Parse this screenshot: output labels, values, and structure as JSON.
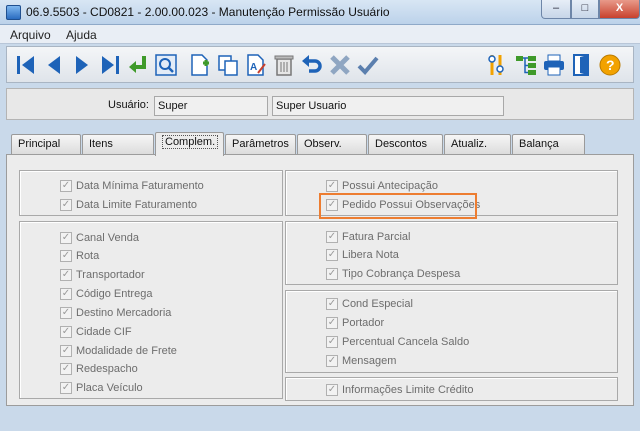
{
  "window": {
    "title": "06.9.5503 - CD0821 - 2.00.00.023 - Manutenção Permissão Usuário",
    "minimize_label": "–",
    "maximize_label": "□",
    "close_label": "X"
  },
  "menu": {
    "items": [
      {
        "label": "Arquivo"
      },
      {
        "label": "Ajuda"
      }
    ]
  },
  "toolbar": {
    "buttons": [
      {
        "icon": "first-record-icon"
      },
      {
        "icon": "previous-record-icon"
      },
      {
        "icon": "next-record-icon"
      },
      {
        "icon": "last-record-icon"
      },
      {
        "icon": "goto-icon"
      },
      {
        "icon": "search-icon"
      },
      {
        "icon": "new-record-icon"
      },
      {
        "icon": "copy-icon"
      },
      {
        "icon": "edit-icon"
      },
      {
        "icon": "delete-icon"
      },
      {
        "icon": "undo-icon"
      },
      {
        "icon": "cancel-icon"
      },
      {
        "icon": "save-icon"
      },
      {
        "icon": "tools-icon"
      },
      {
        "icon": "tree-icon"
      },
      {
        "icon": "print-icon"
      },
      {
        "icon": "exit-icon"
      },
      {
        "icon": "help-icon"
      }
    ],
    "colors": {
      "blue": "#1e63b8",
      "green": "#3f9a2a",
      "orange": "#f2a200"
    }
  },
  "header": {
    "user_label": "Usuário:",
    "user_code": "Super",
    "user_name": "Super Usuario"
  },
  "tabs": [
    {
      "label": "Principal",
      "active": false
    },
    {
      "label": "Itens",
      "active": false
    },
    {
      "label": "Complem.",
      "active": true
    },
    {
      "label": "Parâmetros",
      "active": false
    },
    {
      "label": "Observ.",
      "active": false
    },
    {
      "label": "Descontos",
      "active": false
    },
    {
      "label": "Atualiz.",
      "active": false
    },
    {
      "label": "Balança",
      "active": false
    }
  ],
  "left_groups": [
    {
      "items": [
        {
          "label": "Data Mínima Faturamento",
          "checked": true
        },
        {
          "label": "Data Limite Faturamento",
          "checked": true
        }
      ]
    },
    {
      "items": [
        {
          "label": "Canal Venda",
          "checked": true
        },
        {
          "label": "Rota",
          "checked": true
        },
        {
          "label": "Transportador",
          "checked": true
        },
        {
          "label": "Código Entrega",
          "checked": true
        },
        {
          "label": "Destino Mercadoria",
          "checked": true
        },
        {
          "label": "Cidade CIF",
          "checked": true
        },
        {
          "label": "Modalidade de Frete",
          "checked": true
        },
        {
          "label": "Redespacho",
          "checked": true
        },
        {
          "label": "Placa Veículo",
          "checked": true
        }
      ]
    }
  ],
  "right_groups": [
    {
      "items": [
        {
          "label": "Possui Antecipação",
          "checked": true
        },
        {
          "label": "Pedido Possui Observações",
          "checked": true
        }
      ]
    },
    {
      "items": [
        {
          "label": "Fatura Parcial",
          "checked": true
        },
        {
          "label": "Libera Nota",
          "checked": true
        },
        {
          "label": "Tipo Cobrança Despesa",
          "checked": true
        }
      ]
    },
    {
      "items": [
        {
          "label": "Cond Especial",
          "checked": true
        },
        {
          "label": "Portador",
          "checked": true
        },
        {
          "label": "Percentual Cancela Saldo",
          "checked": true
        },
        {
          "label": "Mensagem",
          "checked": true
        }
      ]
    },
    {
      "items": [
        {
          "label": "Informações Limite Crédito",
          "checked": true
        }
      ]
    }
  ],
  "highlight_color": "#ed7d31",
  "check_mark": "✓"
}
